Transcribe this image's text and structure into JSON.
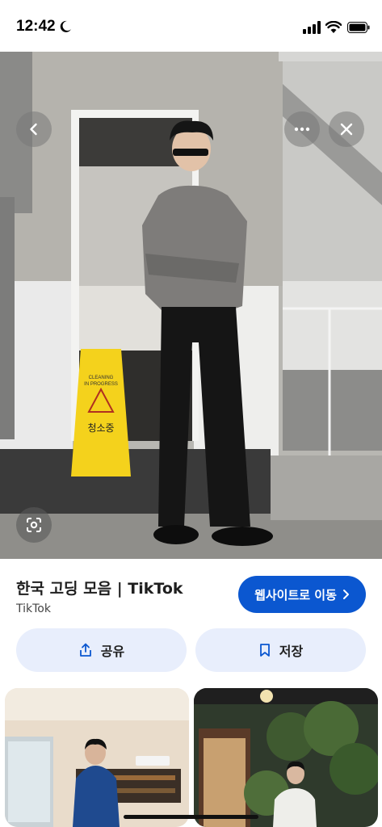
{
  "status": {
    "time": "12:42"
  },
  "hero": {
    "sign_line1": "CLEANING",
    "sign_line2": "IN PROGRESS",
    "sign_korean": "청소중"
  },
  "result": {
    "title": "한국 고딩 모음 | TikTok",
    "source": "TikTok",
    "visit_label": "웹사이트로 이동"
  },
  "actions": {
    "share_label": "공유",
    "save_label": "저장"
  },
  "icons": [
    "moon-icon",
    "signal-icon",
    "wifi-icon",
    "battery-icon",
    "back-icon",
    "more-icon",
    "close-icon",
    "lens-icon",
    "chevron-right-icon",
    "share-icon",
    "bookmark-icon"
  ],
  "colors": {
    "accent": "#0b57d0",
    "pill_bg": "#e8eefc"
  }
}
